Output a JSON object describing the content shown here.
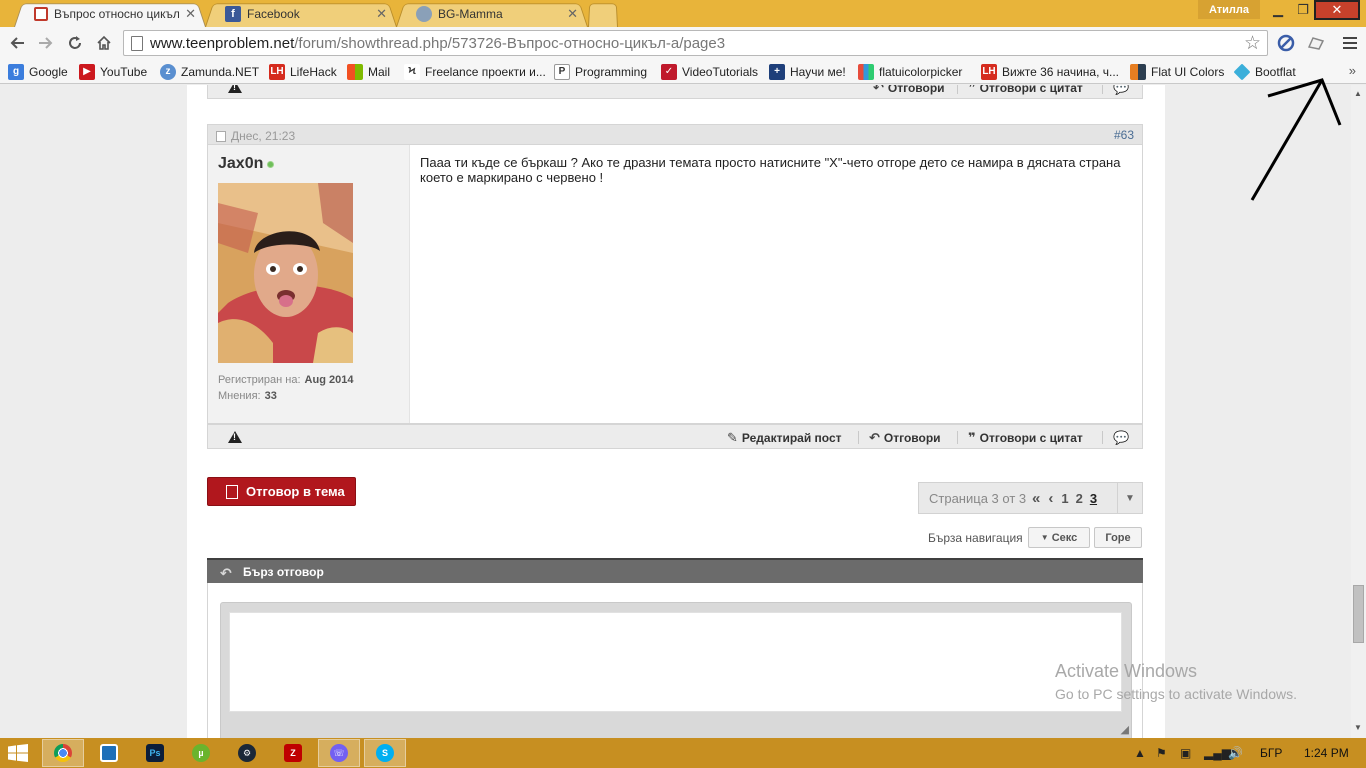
{
  "browser": {
    "tabs": [
      {
        "title": "Въпрос относно цикъл-а",
        "active": true,
        "favicon": "teenproblem-icon"
      },
      {
        "title": "Facebook",
        "active": false,
        "favicon": "facebook-icon"
      },
      {
        "title": "BG-Mamma",
        "active": false,
        "favicon": "bgmamma-icon"
      }
    ],
    "profile_name": "Атилла",
    "url_host": "www.teenproblem.net",
    "url_path": "/forum/showthread.php/573726-Въпрос-относно-цикъл-а/page3",
    "bookmarks": [
      {
        "label": "Google",
        "icon": "google-icon",
        "color": "#3b7ddd"
      },
      {
        "label": "YouTube",
        "icon": "youtube-icon",
        "color": "#cc181e"
      },
      {
        "label": "Zamunda.NET",
        "icon": "zamunda-icon",
        "color": "#5a8fd0"
      },
      {
        "label": "LifeHack",
        "icon": "lifehack-icon",
        "color": "#d52b1e"
      },
      {
        "label": "Mail",
        "icon": "windows-mail-icon",
        "color": "#4a9a2a"
      },
      {
        "label": "Freelance проекти и...",
        "icon": "freelance-icon",
        "color": "#333333"
      },
      {
        "label": "Programming",
        "icon": "programming-icon",
        "color": "#555555"
      },
      {
        "label": "VideoTutorials",
        "icon": "video-tutorials-icon",
        "color": "#c0192c"
      },
      {
        "label": "Научи ме!",
        "icon": "learn-icon",
        "color": "#1e3f7a"
      },
      {
        "label": "flatuicolorpicker",
        "icon": "flatui-picker-icon",
        "color": "#8e44ad"
      },
      {
        "label": "Вижте 36 начина, ч...",
        "icon": "lifehack-icon",
        "color": "#d52b1e"
      },
      {
        "label": "Flat UI Colors",
        "icon": "flatui-colors-icon",
        "color": "#2c3e50"
      },
      {
        "label": "Bootflat",
        "icon": "bootflat-icon",
        "color": "#3bafda"
      }
    ],
    "more_bookmarks": "»"
  },
  "forum": {
    "prev_post_actions": {
      "reply": "Отговори",
      "quote": "Отговори с цитат"
    },
    "post": {
      "date": "Днес, 21:23",
      "number": "#63",
      "username": "Jax0n",
      "registered_label": "Регистриран на:",
      "registered_value": "Aug 2014",
      "posts_label": "Мнения:",
      "posts_value": "33",
      "text": "Пааа ти къде се бъркаш ? Ако те дразни темата просто натисните \"X\"-чето отгоре дето се намира в дясната страна което е маркирано с червено !",
      "actions": {
        "edit": "Редактирай пост",
        "reply": "Отговори",
        "quote": "Отговори с цитат"
      }
    },
    "reply_thread_label": "Отговор в тема",
    "pagination": {
      "info": "Страница 3 от 3",
      "pages": [
        "1",
        "2",
        "3"
      ],
      "current": "3"
    },
    "quick_nav": {
      "label": "Бърза навигация",
      "section": "Секс",
      "top": "Горе"
    },
    "quick_reply_title": "Бърз отговор"
  },
  "watermark": {
    "line1": "Activate Windows",
    "line2": "Go to PC settings to activate Windows."
  },
  "taskbar": {
    "apps": [
      "windows-explorer",
      "chrome",
      "file-explorer",
      "photoshop",
      "utorrent",
      "steam",
      "filezilla",
      "viber",
      "skype"
    ],
    "language": "БГР",
    "time": "1:24 PM"
  },
  "colors": {
    "title_bar": "#e8b43a",
    "taskbar": "#c78f21",
    "reply_button": "#b1171d",
    "quick_reply_header": "#6b6b6b"
  }
}
